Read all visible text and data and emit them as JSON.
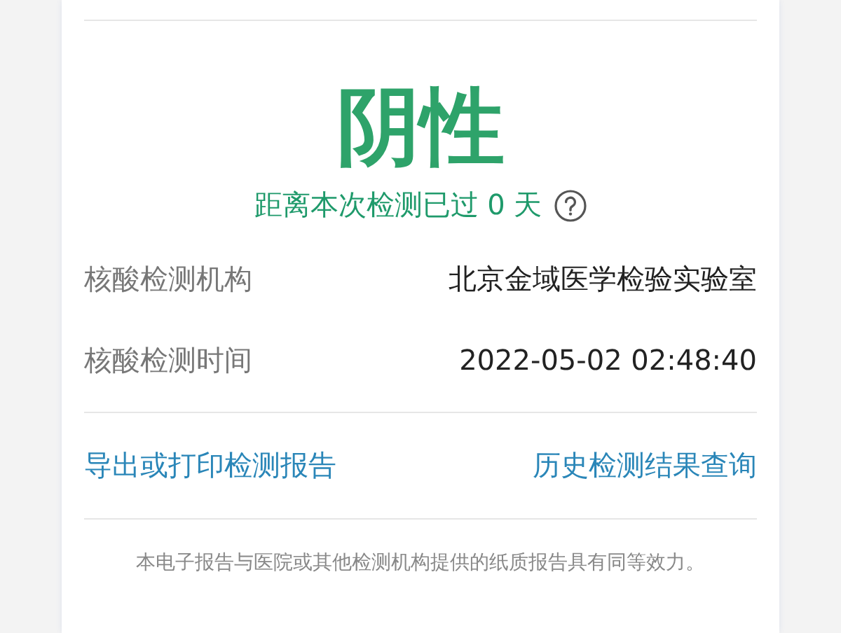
{
  "result": {
    "status": "阴性",
    "elapsed": "距离本次检测已过 0 天"
  },
  "details": [
    {
      "label": "核酸检测机构",
      "value": "北京金域医学检验实验室"
    },
    {
      "label": "核酸检测时间",
      "value": "2022-05-02 02:48:40"
    }
  ],
  "links": [
    "导出或打印检测报告",
    "历史检测结果查询"
  ],
  "footer": "本电子报告与医院或其他检测机构提供的纸质报告具有同等效力。"
}
